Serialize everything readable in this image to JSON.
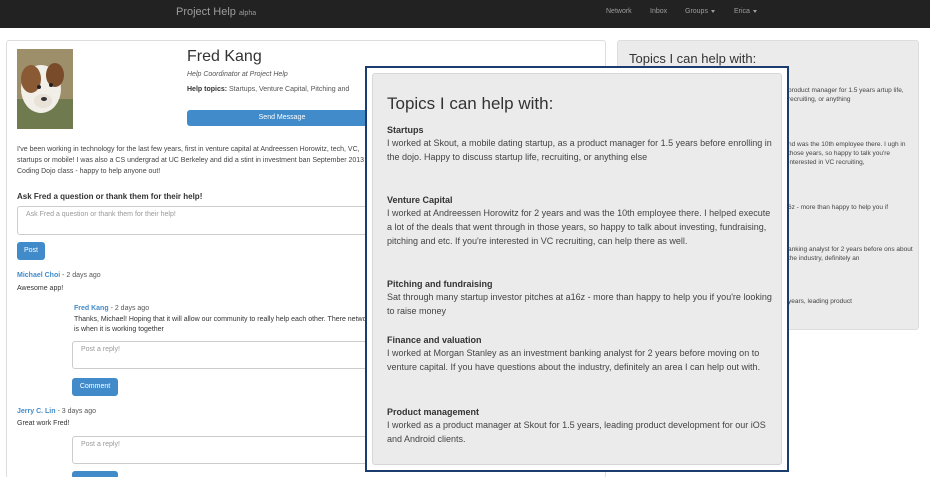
{
  "navbar": {
    "brand": "Project Help",
    "brand_tag": "alpha",
    "links": {
      "network": "Network",
      "inbox": "Inbox",
      "groups": "Groups",
      "user": "Erica"
    }
  },
  "profile": {
    "name": "Fred Kang",
    "title": "Help Coordinator at Project Help",
    "topics_label": "Help topics:",
    "topics_value": "Startups, Venture Capital, Pitching and",
    "send_button": "Send Message",
    "bio": "I've been working in technology for the last few years, first in venture capital at Andreessen Horowitz, tech, VC, startups or mobile! I was also a CS undergrad at UC Berkeley and did a stint in investment ban September 2013 Coding Dojo class - happy to help anyone out!"
  },
  "ask": {
    "heading": "Ask Fred a question or thank them for their help!",
    "placeholder": "Ask Fred a question or thank them for their help!",
    "post_button": "Post"
  },
  "comments": [
    {
      "author": "Michael Choi",
      "time": " - 2 days ago",
      "text": "Awesome app!",
      "reply": {
        "author": "Fred Kang",
        "time": " - 2 days ago",
        "text": "Thanks, Michael! Hoping that it will allow our community to really help each other. There network is when it is working together"
      },
      "reply_placeholder": "Post a reply!",
      "comment_button": "Comment"
    },
    {
      "author": "Jerry C. Lin",
      "time": " - 3 days ago",
      "text": "Great work Fred!",
      "reply_placeholder": "Post a reply!"
    }
  ],
  "sidebar": {
    "title": "Topics I can help with:",
    "fragments": [
      "product manager for 1.5 years artup life, recruiting, or anything",
      "nd was the 10th employee there. I ugh in those years, so happy to talk you're interested in VC recruiting,",
      "6z - more than happy to help you if",
      "anking analyst for 2 years before ons about the industry, definitely an",
      "years, leading product"
    ]
  },
  "popup": {
    "title": "Topics I can help with:",
    "topics": [
      {
        "heading": "Startups",
        "body": "I worked at Skout, a mobile dating startup, as a product manager for 1.5 years before enrolling in the dojo. Happy to discuss startup life, recruiting, or anything else"
      },
      {
        "heading": "Venture Capital",
        "body": "I worked at Andreessen Horowitz for 2 years and was the 10th employee there. I helped execute a lot of the deals that went through in those years, so happy to talk about investing, fundraising, pitching and etc. If you're interested in VC recruiting, can help there as well."
      },
      {
        "heading": "Pitching and fundraising",
        "body": "Sat through many startup investor pitches at a16z - more than happy to help you if you're looking to raise money"
      },
      {
        "heading": "Finance and valuation",
        "body": "I worked at Morgan Stanley as an investment banking analyst for 2 years before moving on to venture capital. If you have questions about the industry, definitely an area I can help out with."
      },
      {
        "heading": "Product management",
        "body": "I worked as a product manager at Skout for 1.5 years, leading product development for our iOS and Android clients."
      }
    ]
  }
}
